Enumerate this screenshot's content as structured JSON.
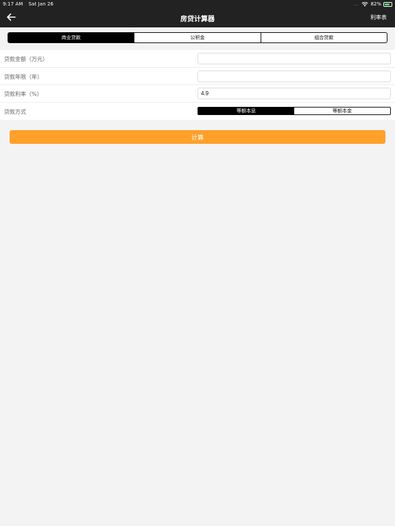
{
  "status_bar": {
    "time": "9:17 AM",
    "date": "Sat Jan 26",
    "dots": "....",
    "battery_pct": "82%",
    "battery_level": 0.82
  },
  "nav": {
    "back_icon": "arrow-left-icon",
    "title": "房贷计算器",
    "right_link": "利率表"
  },
  "tabs": [
    {
      "label": "商业贷款",
      "active": true
    },
    {
      "label": "公积金",
      "active": false
    },
    {
      "label": "组合贷款",
      "active": false
    }
  ],
  "form": {
    "amount_label": "贷款金额（万元）",
    "amount_value": "",
    "term_label": "贷款年限（年）",
    "term_value": "",
    "rate_label": "贷款利率（%）",
    "rate_value": "4.9",
    "method_label": "贷款方式",
    "methods": [
      {
        "label": "等额本息",
        "active": true
      },
      {
        "label": "等额本金",
        "active": false
      }
    ]
  },
  "calculate_label": "计算",
  "colors": {
    "accent": "#ffa02a",
    "nav_bg": "#222222",
    "page_bg": "#f3f3f3"
  }
}
